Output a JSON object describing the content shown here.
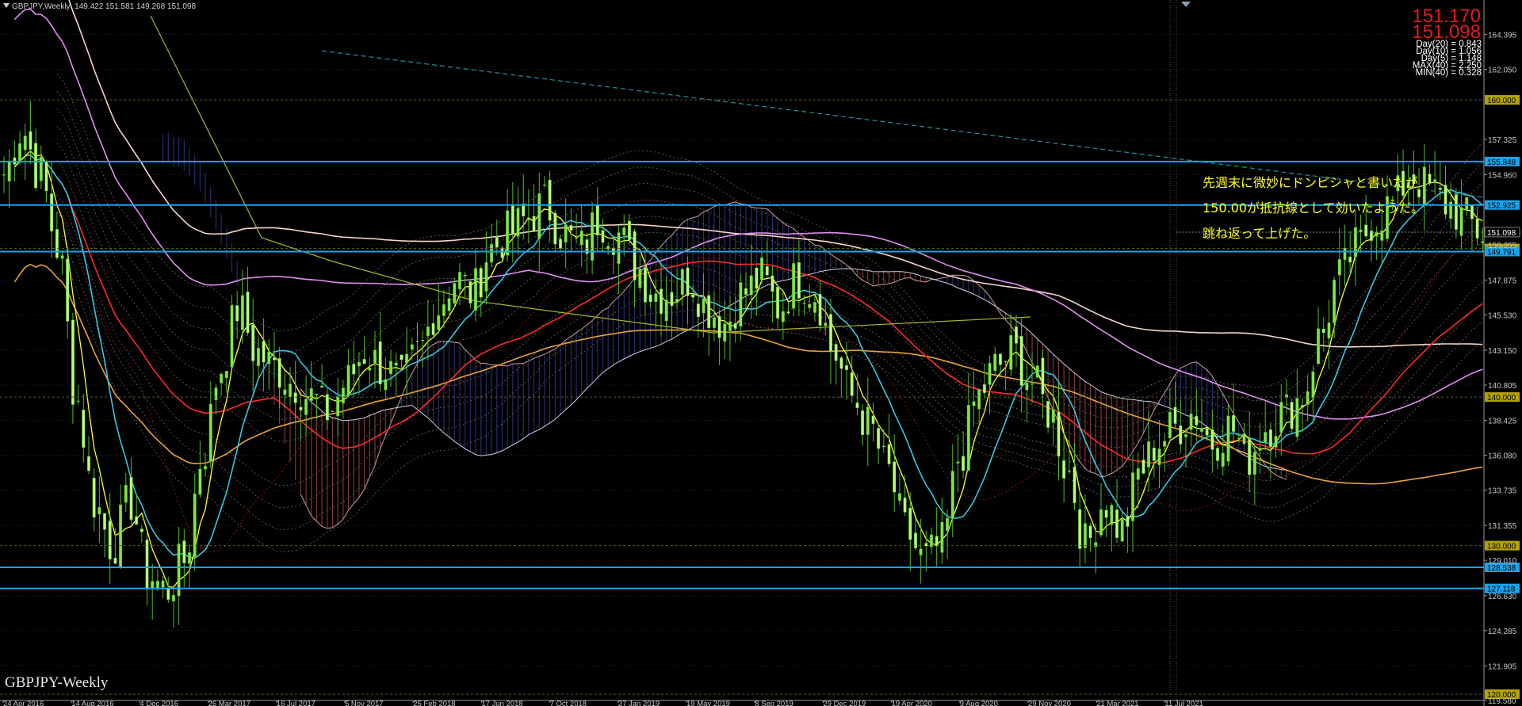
{
  "header": {
    "symbol": "GBPJPY,Weekly",
    "ohlc": "149.422 151.581 149.268 151.098"
  },
  "watermark": "GBPJPY-Weekly",
  "price_display": {
    "bid": "151.170",
    "ask": "151.098",
    "stats": [
      "Day(20) = 0.843",
      "Day(10) = 1.056",
      "Day(5) = 1.148",
      "MAX(40) = 2.250",
      "MIN(40) = 0.328"
    ]
  },
  "annotation": [
    "先週末に微妙にドンピシャと書いたが",
    "150.00が抵抗線として効いたようだ。",
    "跳ね返って上げた。"
  ],
  "colors": {
    "background": "#000000",
    "candle_up": "#7fe64a",
    "candle_down": "#b7ff7a",
    "hline": "#1aa3e8",
    "label_box": "#1aa3e8",
    "label_round": "#b3a200",
    "sma_fast": "#ffff33",
    "sma_mid": "#37c7e6",
    "sma_slow": "#ff2a2a",
    "sma_long": "#e8a33a",
    "sma_200": "#f4d6c8",
    "sma_pink": "#e28ef0",
    "cloud_bear": "#b05050",
    "cloud_bull": "#3c3f9a"
  },
  "chart_data": {
    "type": "line",
    "title": "GBPJPY,Weekly",
    "ylim": [
      119.58,
      166.4
    ],
    "y_ticks": [
      "164.395",
      "162.050",
      "157.325",
      "154.960",
      "150.255",
      "147.875",
      "145.530",
      "143.150",
      "140.805",
      "138.425",
      "136.080",
      "133.735",
      "131.355",
      "129.010",
      "126.630",
      "124.285",
      "121.905",
      "119.580"
    ],
    "x_ticks": [
      "24 Apr 2016",
      "14 Aug 2016",
      "4 Dec 2016",
      "26 Mar 2017",
      "16 Jul 2017",
      "5 Nov 2017",
      "25 Feb 2018",
      "17 Jun 2018",
      "7 Oct 2018",
      "27 Jan 2019",
      "19 May 2019",
      "8 Sep 2019",
      "29 Dec 2019",
      "19 Apr 2020",
      "9 Aug 2020",
      "29 Nov 2020",
      "21 Mar 2021",
      "11 Jul 2021"
    ],
    "horizontal_levels": [
      {
        "label": "160.000",
        "value": 160.0,
        "style": "round"
      },
      {
        "label": "155.848",
        "value": 155.848,
        "style": "box"
      },
      {
        "label": "152.925",
        "value": 152.925,
        "style": "box"
      },
      {
        "label": "151.098",
        "value": 151.098,
        "style": "price"
      },
      {
        "label": "150.000",
        "value": 150.0,
        "style": "round"
      },
      {
        "label": "149.791",
        "value": 149.791,
        "style": "box"
      },
      {
        "label": "140.000",
        "value": 140.0,
        "style": "round"
      },
      {
        "label": "130.000",
        "value": 130.0,
        "style": "round"
      },
      {
        "label": "128.538",
        "value": 128.538,
        "style": "box"
      },
      {
        "label": "127.118",
        "value": 127.118,
        "style": "box"
      },
      {
        "label": "120.000",
        "value": 120.0,
        "style": "round"
      }
    ],
    "close_path": [
      [
        0,
        155
      ],
      [
        1,
        158
      ],
      [
        2,
        155
      ],
      [
        3,
        150
      ],
      [
        4,
        140
      ],
      [
        5,
        133
      ],
      [
        6,
        130
      ],
      [
        7,
        133
      ],
      [
        8,
        128
      ],
      [
        9,
        127
      ],
      [
        10,
        129
      ],
      [
        11,
        136
      ],
      [
        12,
        142
      ],
      [
        13,
        146
      ],
      [
        14,
        143
      ],
      [
        15,
        142
      ],
      [
        16,
        141
      ],
      [
        17,
        140
      ],
      [
        18,
        139
      ],
      [
        19,
        141
      ],
      [
        20,
        143
      ],
      [
        21,
        142
      ],
      [
        22,
        141
      ],
      [
        23,
        143
      ],
      [
        24,
        146
      ],
      [
        25,
        148
      ],
      [
        26,
        147
      ],
      [
        27,
        150
      ],
      [
        28,
        151
      ],
      [
        29,
        152
      ],
      [
        30,
        153
      ],
      [
        31,
        151
      ],
      [
        32,
        150
      ],
      [
        33,
        152
      ],
      [
        34,
        151
      ],
      [
        35,
        149
      ],
      [
        36,
        147
      ],
      [
        37,
        147
      ],
      [
        38,
        148
      ],
      [
        39,
        146
      ],
      [
        40,
        145
      ],
      [
        41,
        147
      ],
      [
        42,
        148
      ],
      [
        43,
        146
      ],
      [
        44,
        148
      ],
      [
        45,
        147
      ],
      [
        46,
        143
      ],
      [
        47,
        140
      ],
      [
        48,
        138
      ],
      [
        49,
        135
      ],
      [
        50,
        131
      ],
      [
        51,
        129
      ],
      [
        52,
        130
      ],
      [
        53,
        136
      ],
      [
        54,
        140
      ],
      [
        55,
        142
      ],
      [
        56,
        143
      ],
      [
        57,
        141
      ],
      [
        58,
        139
      ],
      [
        59,
        135
      ],
      [
        60,
        130
      ],
      [
        61,
        133
      ],
      [
        62,
        131
      ],
      [
        63,
        135
      ],
      [
        64,
        137
      ],
      [
        65,
        138
      ],
      [
        66,
        139
      ],
      [
        67,
        137
      ],
      [
        68,
        138
      ],
      [
        69,
        136
      ],
      [
        70,
        138
      ],
      [
        71,
        139
      ],
      [
        72,
        140
      ],
      [
        73,
        144
      ],
      [
        74,
        148
      ],
      [
        75,
        150
      ],
      [
        76,
        152
      ],
      [
        77,
        153
      ],
      [
        78,
        155
      ],
      [
        79,
        154
      ],
      [
        80,
        153
      ],
      [
        81,
        152
      ],
      [
        82,
        151
      ]
    ]
  }
}
